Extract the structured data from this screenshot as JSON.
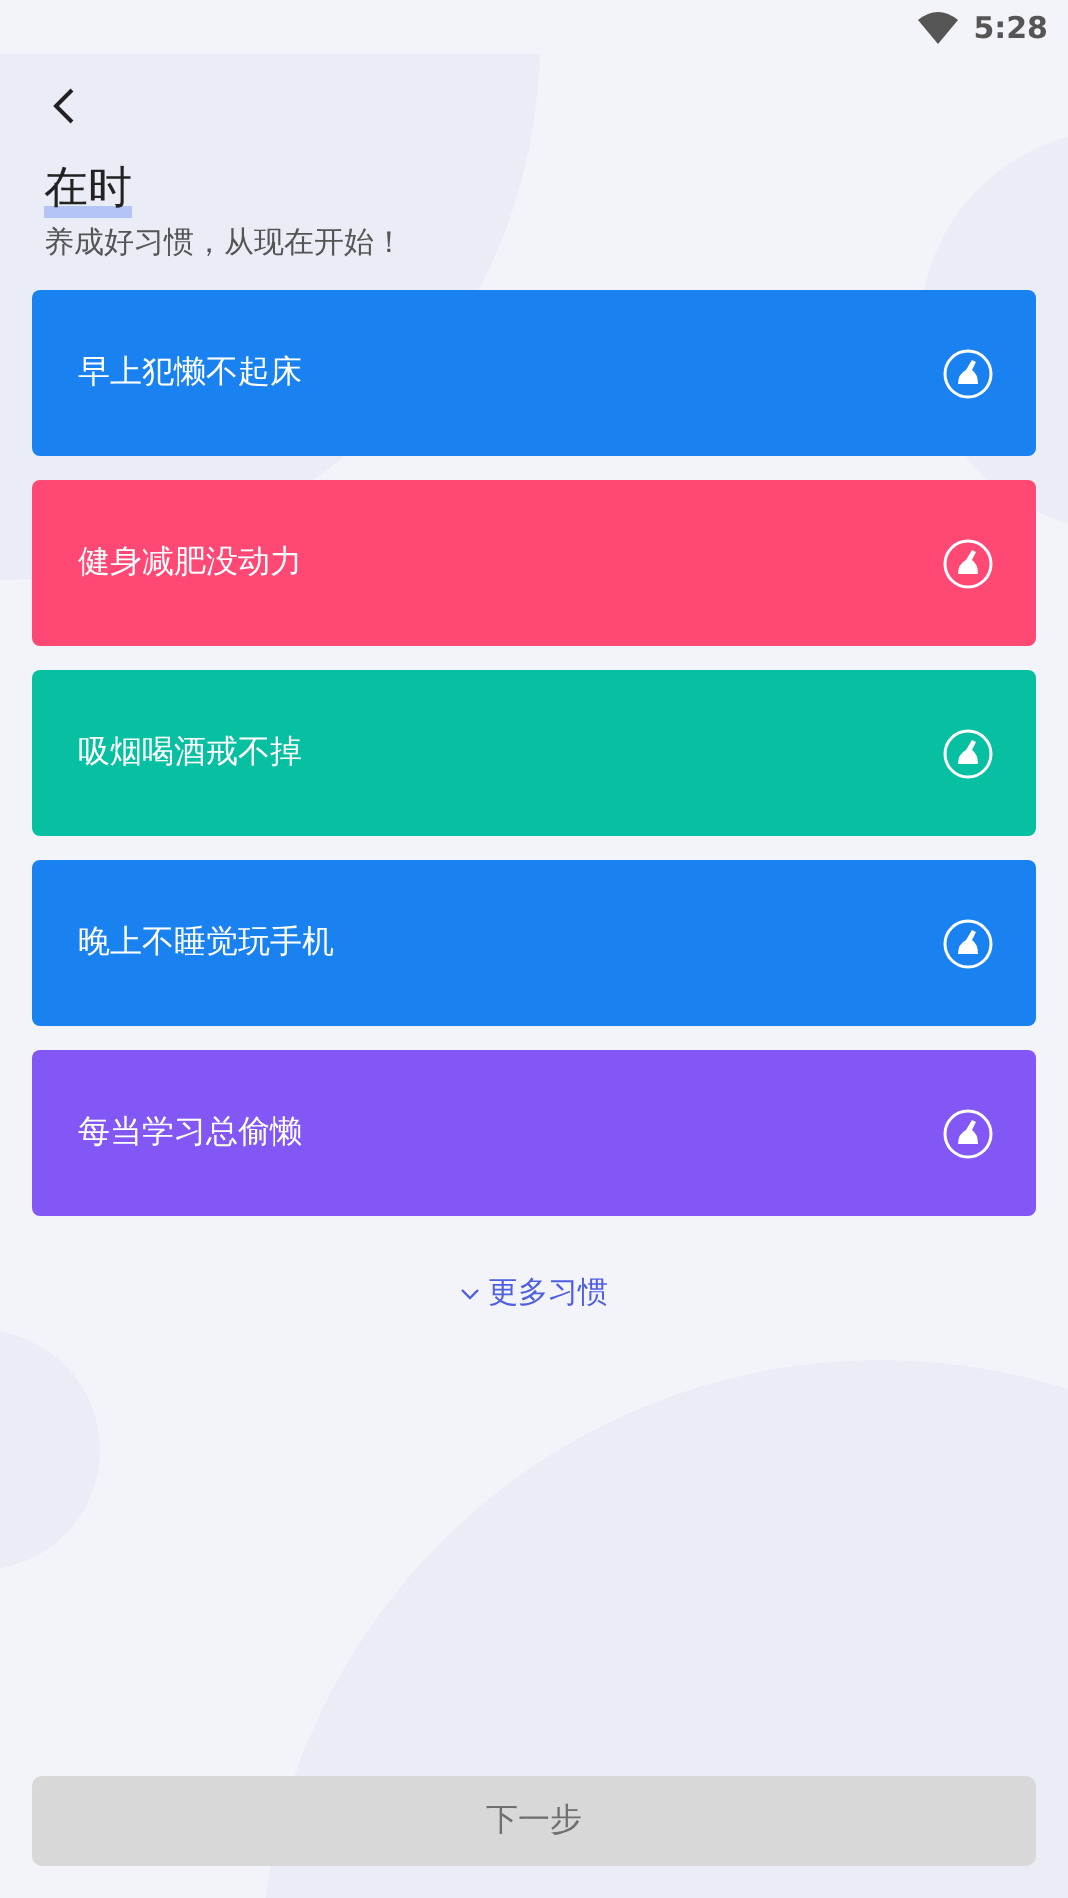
{
  "status_bar": {
    "time": "5:28"
  },
  "header": {
    "title": "在时",
    "subtitle": "养成好习惯，从现在开始！"
  },
  "habits": [
    {
      "label": "早上犯懒不起床",
      "color": "#1a82f0"
    },
    {
      "label": "健身减肥没动力",
      "color": "#ff4874"
    },
    {
      "label": "吸烟喝酒戒不掉",
      "color": "#07c0a2"
    },
    {
      "label": "晚上不睡觉玩手机",
      "color": "#1a82f0"
    },
    {
      "label": "每当学习总偷懒",
      "color": "#8257f5"
    }
  ],
  "more_link": {
    "label": "更多习惯",
    "expanded": false
  },
  "next_button": {
    "label": "下一步",
    "disabled": true
  }
}
